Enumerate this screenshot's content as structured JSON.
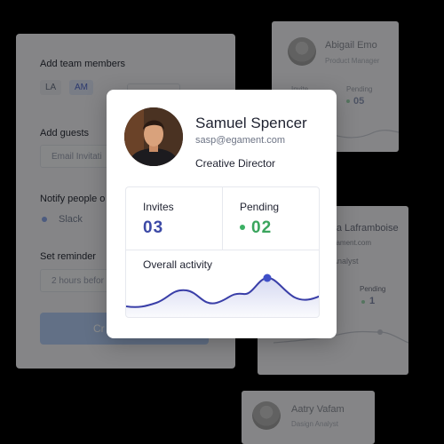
{
  "form": {
    "add_team_members": "Add team members",
    "chips": [
      "LA",
      "AM"
    ],
    "add_guests": "Add guests",
    "email_placeholder": "Email Invitati",
    "notify_label": "Notify people o",
    "notify_option": "Slack",
    "reminder_label": "Set reminder",
    "reminder_placeholder": "2 hours befor",
    "submit_label": "Cr"
  },
  "card_abigail": {
    "name": "Abigail Emo",
    "role": "Product Manager",
    "invites_label": "Invite",
    "pending_label": "Pending",
    "pending_value": "05"
  },
  "card_lia": {
    "name": "lia Laframboise",
    "email": "gament.com",
    "role": "Analyst",
    "pending_label": "Pending",
    "pending_value": "1"
  },
  "card_aatry": {
    "name": "Aatry Vafam",
    "role": "Dasign Analyst"
  },
  "profile": {
    "name": "Samuel Spencer",
    "email": "sasp@egament.com",
    "role": "Creative Director",
    "invites_label": "Invites",
    "invites_value": "03",
    "pending_label": "Pending",
    "pending_value": "02",
    "activity_label": "Overall activity"
  },
  "colors": {
    "accent_blue": "#3c49a6",
    "accent_green": "#3aa55d"
  }
}
